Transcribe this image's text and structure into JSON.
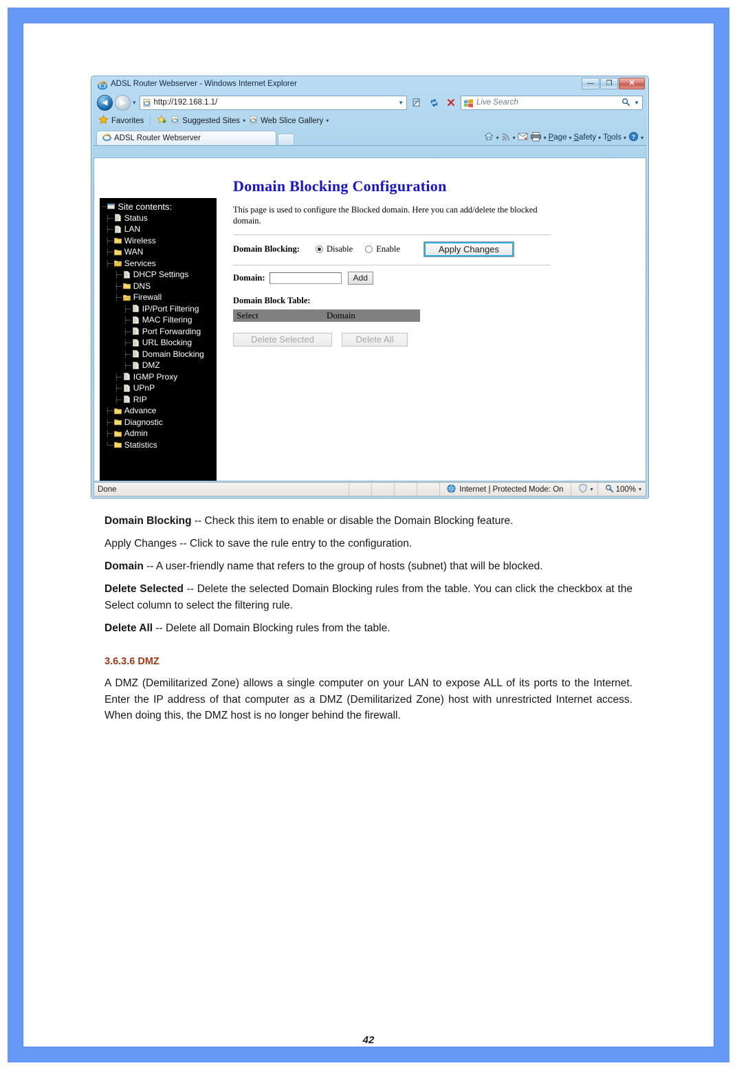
{
  "browser": {
    "window_title": "ADSL Router Webserver - Windows Internet Explorer",
    "minimize_label": "—",
    "restore_label": "❐",
    "close_label": "✕",
    "back_glyph": "◀",
    "forward_glyph": "▶",
    "address_value": "http://192.168.1.1/",
    "address_dropdown_glyph": "▼",
    "nav_dropdown_glyph": "▾",
    "compat_glyph": "❐",
    "refresh_glyph": "↻",
    "stop_glyph": "✕",
    "search_placeholder": "Live Search",
    "search_mag_glyph": "ὐD",
    "search_dropdown_glyph": "▼",
    "favorites": {
      "favorites_label": "Favorites",
      "suggested_sites_label": "Suggested Sites",
      "web_slice_label": "Web Slice Gallery",
      "caret_glyph": "▾"
    },
    "tab_label": "ADSL Router Webserver",
    "command_bar": {
      "home_caret": "▾",
      "feeds_caret": "▾",
      "mail_caret": "▾",
      "print_caret": "▾",
      "page_label": "Page",
      "safety_label": "Safety",
      "tools_label": "Tools",
      "help_caret": "▾"
    },
    "status_bar": {
      "status_text": "Done",
      "zone_text": "Internet | Protected Mode: On",
      "zone_caret": "▾",
      "zoom_text": "100%",
      "zoom_caret": "▾"
    }
  },
  "router_page": {
    "sidebar": {
      "root_label": "Site contents:",
      "items": [
        {
          "label": "Status",
          "icon": "page-icon",
          "depth": 1
        },
        {
          "label": "LAN",
          "icon": "page-icon",
          "depth": 1
        },
        {
          "label": "Wireless",
          "icon": "folder-icon",
          "depth": 1
        },
        {
          "label": "WAN",
          "icon": "folder-icon",
          "depth": 1
        },
        {
          "label": "Services",
          "icon": "folder-open-icon",
          "depth": 1
        },
        {
          "label": "DHCP Settings",
          "icon": "page-icon",
          "depth": 2
        },
        {
          "label": "DNS",
          "icon": "folder-icon",
          "depth": 2
        },
        {
          "label": "Firewall",
          "icon": "folder-open-icon",
          "depth": 2
        },
        {
          "label": "IP/Port Filtering",
          "icon": "page-icon",
          "depth": 3
        },
        {
          "label": "MAC Filtering",
          "icon": "page-icon",
          "depth": 3
        },
        {
          "label": "Port Forwarding",
          "icon": "page-icon",
          "depth": 3
        },
        {
          "label": "URL Blocking",
          "icon": "page-icon",
          "depth": 3
        },
        {
          "label": "Domain Blocking",
          "icon": "page-icon",
          "depth": 3
        },
        {
          "label": "DMZ",
          "icon": "page-icon",
          "depth": 3
        },
        {
          "label": "IGMP Proxy",
          "icon": "page-icon",
          "depth": 2
        },
        {
          "label": "UPnP",
          "icon": "page-icon",
          "depth": 2
        },
        {
          "label": "RIP",
          "icon": "page-icon",
          "depth": 2
        },
        {
          "label": "Advance",
          "icon": "folder-icon",
          "depth": 1
        },
        {
          "label": "Diagnostic",
          "icon": "folder-icon",
          "depth": 1
        },
        {
          "label": "Admin",
          "icon": "folder-icon",
          "depth": 1
        },
        {
          "label": "Statistics",
          "icon": "folder-icon",
          "depth": 1
        }
      ]
    },
    "title": "Domain Blocking Configuration",
    "description": "This page is used to configure the Blocked domain. Here you can add/delete the blocked domain.",
    "domain_blocking_label": "Domain Blocking:",
    "radio_disable_label": "Disable",
    "radio_enable_label": "Enable",
    "radio_selected": "Disable",
    "apply_changes_label": "Apply Changes",
    "domain_label": "Domain:",
    "domain_value": "",
    "add_label": "Add",
    "table_caption": "Domain Block Table:",
    "table_headers": [
      "Select",
      "Domain"
    ],
    "table_rows": [],
    "delete_selected_label": "Delete Selected",
    "delete_all_label": "Delete All",
    "accent_title_color": "#1414d2",
    "table_header_bg": "#808080"
  },
  "document": {
    "paragraphs": [
      {
        "bold": "Domain Blocking",
        "rest": " -- Check this item to enable or disable the Domain Blocking feature.",
        "justify": false
      },
      {
        "bold": "",
        "rest": "Apply Changes -- Click to save the rule entry to the configuration.",
        "justify": false
      },
      {
        "bold": "Domain",
        "rest": " -- A user-friendly name that refers to the group of hosts (subnet) that will be blocked.",
        "justify": true
      },
      {
        "bold": "Delete Selected",
        "rest": " -- Delete the selected Domain Blocking rules from the table. You can click the checkbox at the Select column to select the filtering rule.",
        "justify": true
      },
      {
        "bold": "Delete All",
        "rest": " -- Delete all Domain Blocking rules from the table.",
        "justify": false
      }
    ],
    "section_heading": "3.6.3.6 DMZ",
    "section_heading_color": "#a03a16",
    "section_body": "A DMZ (Demilitarized Zone) allows a single computer on your LAN to expose ALL of its ports to the Internet. Enter the IP address of that computer as a DMZ (Demilitarized Zone) host with unrestricted Internet access. When doing this, the DMZ host is no longer behind the firewall.",
    "page_number": "42"
  },
  "theme": {
    "page_border_blue": "#6699f6",
    "ie_blue": "#1a6db3"
  }
}
